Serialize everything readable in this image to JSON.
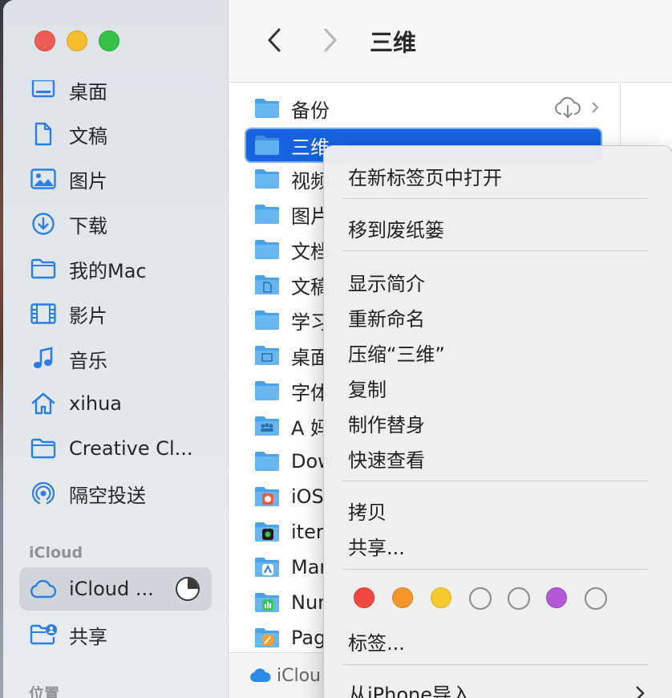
{
  "window": {
    "title": "三维"
  },
  "sidebar": {
    "items": [
      {
        "label": "桌面",
        "icon": "desktop-icon"
      },
      {
        "label": "文稿",
        "icon": "document-icon"
      },
      {
        "label": "图片",
        "icon": "photo-icon"
      },
      {
        "label": "下载",
        "icon": "download-icon"
      },
      {
        "label": "我的Mac",
        "icon": "folder-icon"
      },
      {
        "label": "影片",
        "icon": "film-icon"
      },
      {
        "label": "音乐",
        "icon": "music-note-icon"
      },
      {
        "label": "xihua",
        "icon": "home-icon"
      },
      {
        "label": "Creative Cl...",
        "icon": "folder-icon"
      },
      {
        "label": "隔空投送",
        "icon": "airdrop-icon"
      }
    ],
    "icloud_section": "iCloud",
    "icloud_items": [
      {
        "label": "iCloud ...",
        "icon": "cloud-icon",
        "selected": true
      },
      {
        "label": "共享",
        "icon": "shared-folder-icon"
      }
    ],
    "location_section": "位置"
  },
  "files": [
    {
      "name": "备份",
      "icon": "folder-icon",
      "trailing": "cloud-download-icon"
    },
    {
      "name": "三维",
      "icon": "folder-icon",
      "selected": true
    },
    {
      "name": "视频",
      "icon": "folder-icon"
    },
    {
      "name": "图片",
      "icon": "folder-icon"
    },
    {
      "name": "文档",
      "icon": "folder-icon"
    },
    {
      "name": "文稿",
      "icon": "documents-folder-icon"
    },
    {
      "name": "学习",
      "icon": "folder-icon"
    },
    {
      "name": "桌面",
      "icon": "desktop-folder-icon"
    },
    {
      "name": "字体",
      "icon": "folder-icon"
    },
    {
      "name": "A 妈",
      "icon": "shared-group-folder-icon"
    },
    {
      "name": "Dow",
      "icon": "folder-icon"
    },
    {
      "name": "iOS",
      "icon": "app-folder-icon"
    },
    {
      "name": "iter",
      "icon": "app-folder-icon"
    },
    {
      "name": "Mar",
      "icon": "app-folder-icon"
    },
    {
      "name": "Nur",
      "icon": "app-folder-icon"
    },
    {
      "name": "Pag",
      "icon": "app-folder-icon"
    }
  ],
  "statusbar": {
    "label": "iClou"
  },
  "context_menu": {
    "groups": [
      [
        "在新标签页中打开"
      ],
      [
        "移到废纸篓"
      ],
      [
        "显示简介",
        "重新命名",
        "压缩“三维”",
        "复制",
        "制作替身",
        "快速查看"
      ],
      [
        "拷贝",
        "共享..."
      ]
    ],
    "tags_label": "标签...",
    "import_label": "从iPhone导入",
    "tag_colors": [
      "#f24841",
      "#f7952b",
      "#f8c92c",
      "none",
      "none",
      "#b35ad7",
      "none"
    ]
  },
  "colors": {
    "accent": "#1662e0",
    "sidebar_icon": "#2a7ee6"
  }
}
